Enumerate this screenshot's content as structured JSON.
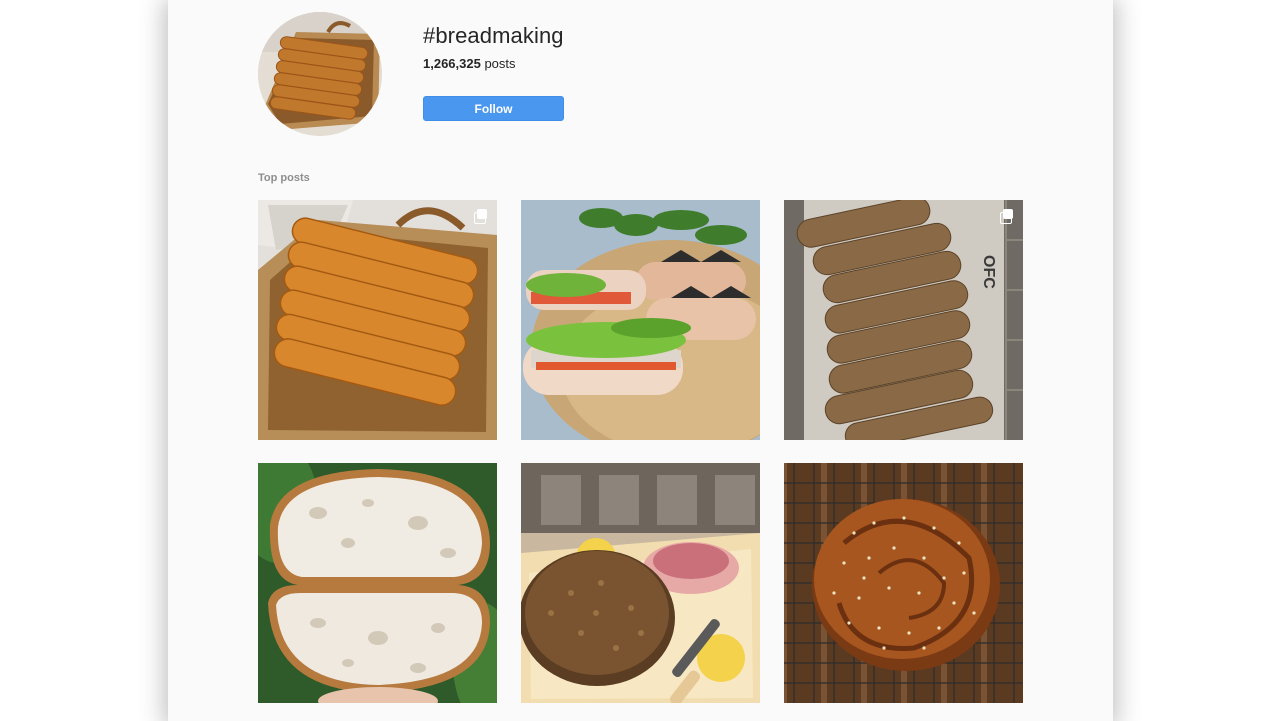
{
  "header": {
    "hashtag": "#breadmaking",
    "post_count": "1,266,325",
    "post_count_suffix": " posts",
    "follow_label": "Follow"
  },
  "sections": {
    "top_posts_label": "Top posts"
  },
  "posts": [
    {
      "image": "braided bread loaf on wicker tray",
      "multi_photo": true
    },
    {
      "image": "sandwiches on wooden board",
      "multi_photo": false
    },
    {
      "image": "sesame baguettes on wooden board",
      "multi_photo": true
    },
    {
      "image": "sourdough loaf cut in half",
      "multi_photo": false
    },
    {
      "image": "round seeded loaf with knife and bowl",
      "multi_photo": false
    },
    {
      "image": "sesame bread on cooling rack",
      "multi_photo": false
    }
  ],
  "colors": {
    "accent": "#4a97f0",
    "background": "#fafafa",
    "text": "#262626",
    "muted": "#8e8e8e"
  }
}
